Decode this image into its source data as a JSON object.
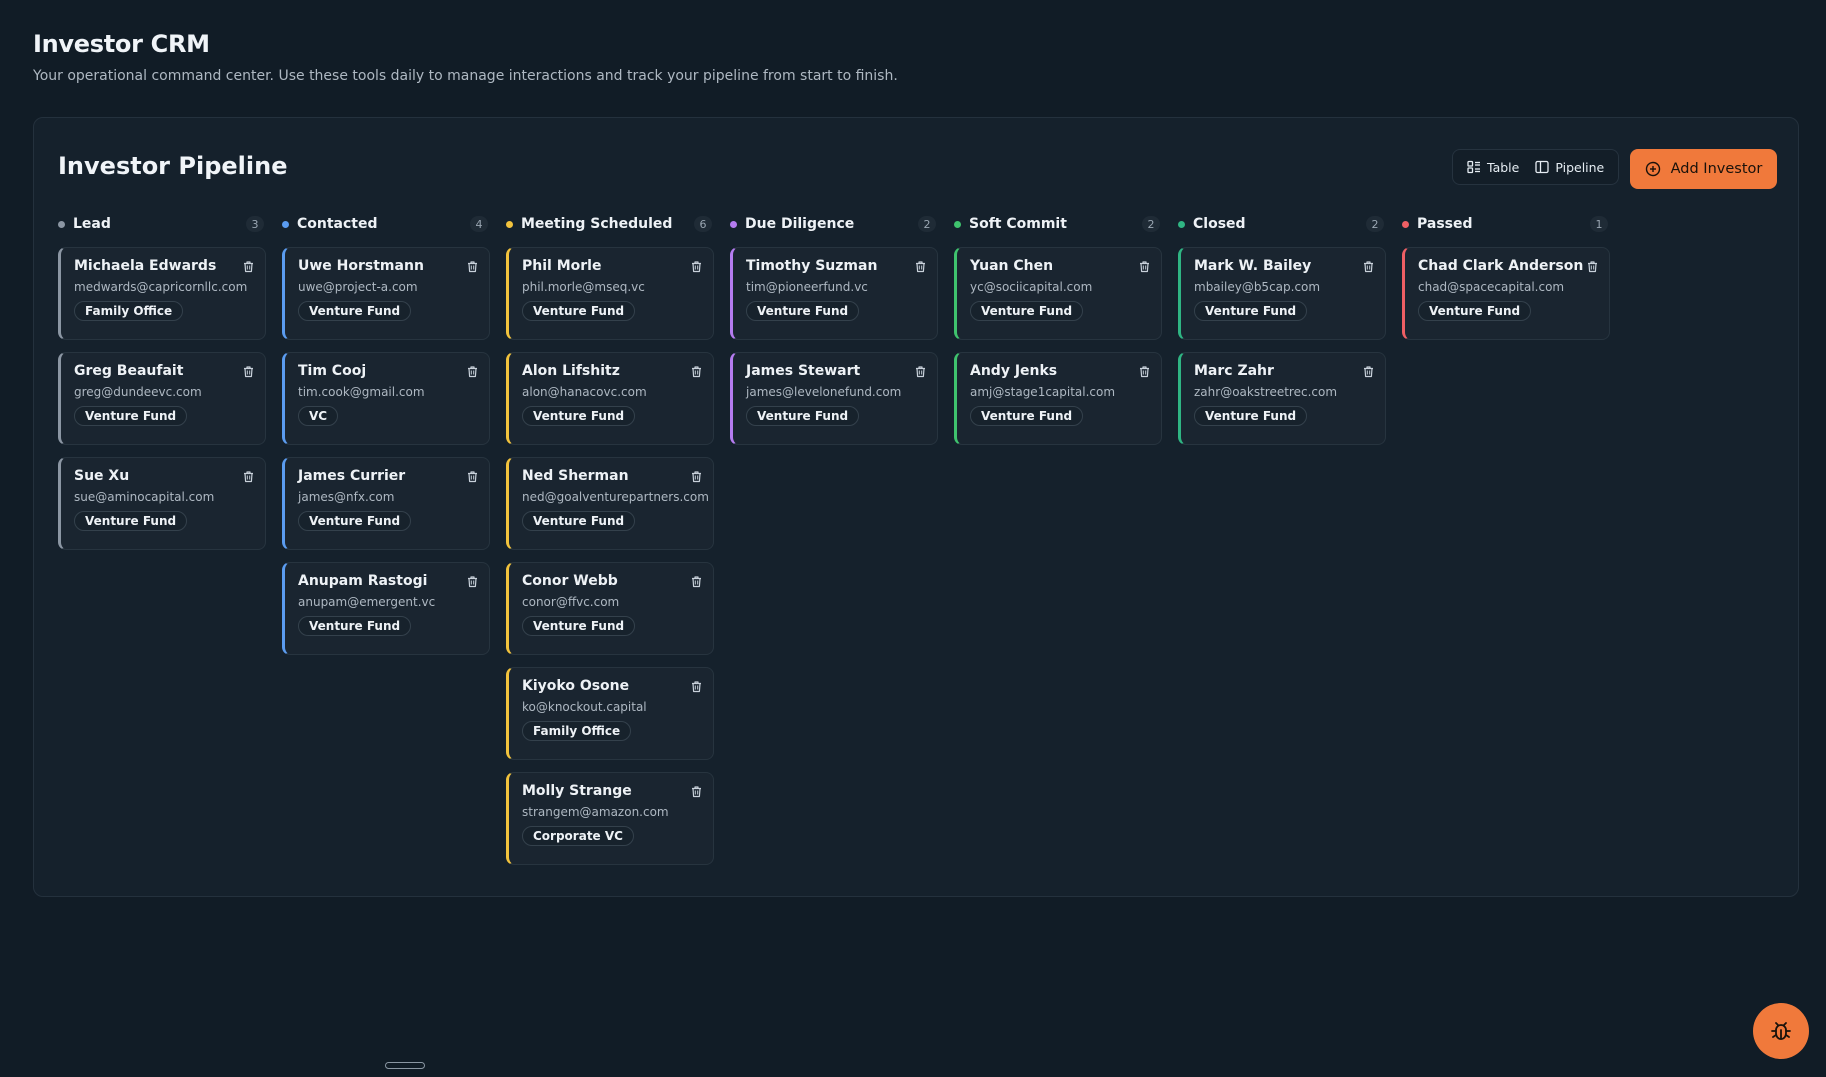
{
  "header": {
    "title": "Investor CRM",
    "subtitle": "Your operational command center. Use these tools daily to manage interactions and track your pipeline from start to finish."
  },
  "panel": {
    "title": "Investor Pipeline",
    "view_toggle": {
      "table_label": "Table",
      "pipeline_label": "Pipeline"
    },
    "add_button_label": "Add Investor"
  },
  "icons": {
    "table": "table-icon",
    "pipeline": "columns-icon",
    "add": "plus-circle-icon",
    "delete": "trash-icon",
    "fab": "bug-icon"
  },
  "colors": {
    "accent": "#f0793b",
    "background": "#111c26"
  },
  "columns": [
    {
      "title": "Lead",
      "count": "3",
      "color": "#8b96a3",
      "cards": [
        {
          "name": "Michaela Edwards",
          "email": "medwards@capricornllc.com",
          "tag": "Family Office"
        },
        {
          "name": "Greg Beaufait",
          "email": "greg@dundeevc.com",
          "tag": "Venture Fund"
        },
        {
          "name": "Sue Xu",
          "email": "sue@aminocapital.com",
          "tag": "Venture Fund"
        }
      ]
    },
    {
      "title": "Contacted",
      "count": "4",
      "color": "#5b9cf0",
      "cards": [
        {
          "name": "Uwe Horstmann",
          "email": "uwe@project-a.com",
          "tag": "Venture Fund"
        },
        {
          "name": "Tim Cooj",
          "email": "tim.cook@gmail.com",
          "tag": "VC"
        },
        {
          "name": "James Currier",
          "email": "james@nfx.com",
          "tag": "Venture Fund"
        },
        {
          "name": "Anupam Rastogi",
          "email": "anupam@emergent.vc",
          "tag": "Venture Fund"
        }
      ]
    },
    {
      "title": "Meeting Scheduled",
      "count": "6",
      "color": "#f2c33d",
      "cards": [
        {
          "name": "Phil Morle",
          "email": "phil.morle@mseq.vc",
          "tag": "Venture Fund"
        },
        {
          "name": "Alon Lifshitz",
          "email": "alon@hanacovc.com",
          "tag": "Venture Fund"
        },
        {
          "name": "Ned Sherman",
          "email": "ned@goalventurepartners.com",
          "tag": "Venture Fund"
        },
        {
          "name": "Conor Webb",
          "email": "conor@ffvc.com",
          "tag": "Venture Fund"
        },
        {
          "name": "Kiyoko Osone",
          "email": "ko@knockout.capital",
          "tag": "Family Office"
        },
        {
          "name": "Molly Strange",
          "email": "strangem@amazon.com",
          "tag": "Corporate VC"
        }
      ]
    },
    {
      "title": "Due Diligence",
      "count": "2",
      "color": "#b57cf0",
      "cards": [
        {
          "name": "Timothy Suzman",
          "email": "tim@pioneerfund.vc",
          "tag": "Venture Fund"
        },
        {
          "name": "James Stewart",
          "email": "james@levelonefund.com",
          "tag": "Venture Fund"
        }
      ]
    },
    {
      "title": "Soft Commit",
      "count": "2",
      "color": "#3fc36e",
      "cards": [
        {
          "name": "Yuan Chen",
          "email": "yc@sociicapital.com",
          "tag": "Venture Fund"
        },
        {
          "name": "Andy Jenks",
          "email": "amj@stage1capital.com",
          "tag": "Venture Fund"
        }
      ]
    },
    {
      "title": "Closed",
      "count": "2",
      "color": "#2fb583",
      "cards": [
        {
          "name": "Mark W. Bailey",
          "email": "mbailey@b5cap.com",
          "tag": "Venture Fund"
        },
        {
          "name": "Marc Zahr",
          "email": "zahr@oakstreetrec.com",
          "tag": "Venture Fund"
        }
      ]
    },
    {
      "title": "Passed",
      "count": "1",
      "color": "#ef5f64",
      "cards": [
        {
          "name": "Chad Clark Anderson",
          "email": "chad@spacecapital.com",
          "tag": "Venture Fund"
        }
      ]
    }
  ]
}
